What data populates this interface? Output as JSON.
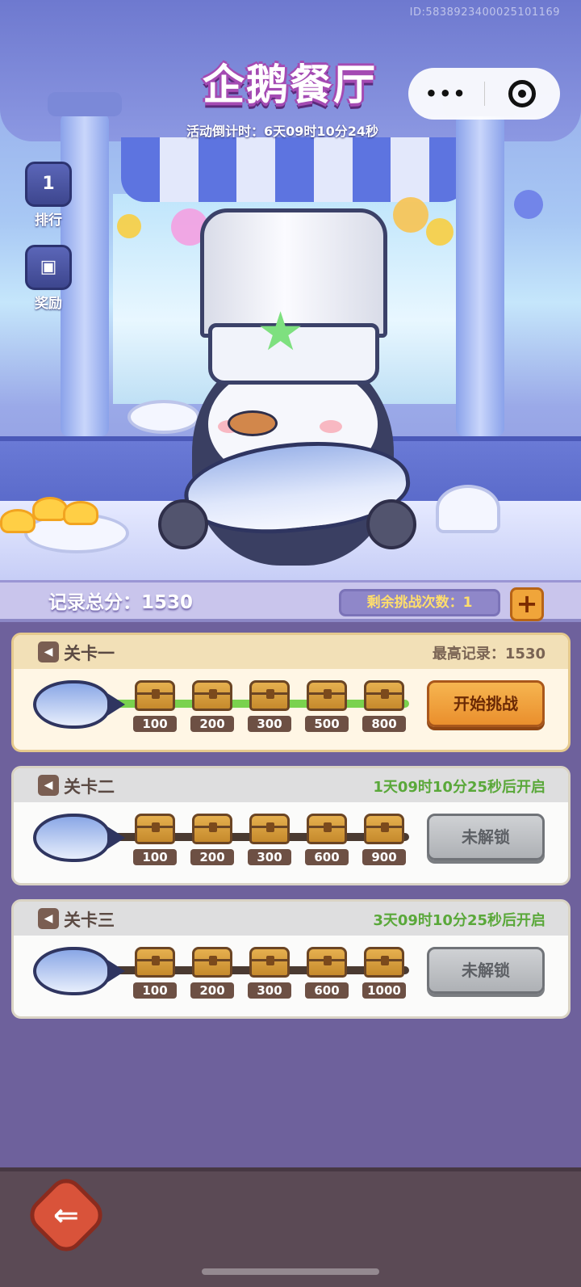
{
  "header": {
    "device_id": "ID:5838923400025101169",
    "title": "企鹅餐厅",
    "countdown": "活动倒计时：6天09时10分24秒",
    "capsule": {
      "more_icon": "more-dots-icon",
      "close_icon": "mini-program-close-icon"
    }
  },
  "side_buttons": [
    {
      "label": "排行",
      "icon": "ranking-podium-icon",
      "badge": "1"
    },
    {
      "label": "奖励",
      "icon": "treasure-chest-icon"
    }
  ],
  "score": {
    "total_label": "记录总分：1530",
    "remaining_label": "剩余挑战次数：1",
    "add_icon": "plus-icon"
  },
  "levels": [
    {
      "name": "关卡一",
      "status_text": "最高记录：1530",
      "status_color": "#7a6454",
      "milestones": [
        "100",
        "200",
        "300",
        "500",
        "800"
      ],
      "button": "开始挑战",
      "unlocked": true
    },
    {
      "name": "关卡二",
      "status_text": "1天09时10分25秒后开启",
      "status_color": "#5aa83a",
      "milestones": [
        "100",
        "200",
        "300",
        "600",
        "900"
      ],
      "button": "未解锁",
      "unlocked": false
    },
    {
      "name": "关卡三",
      "status_text": "3天09时10分25秒后开启",
      "status_color": "#5aa83a",
      "milestones": [
        "100",
        "200",
        "300",
        "600",
        "1000"
      ],
      "button": "未解锁",
      "unlocked": false
    }
  ],
  "footer": {
    "back_icon": "back-arrow-icon"
  },
  "colors": {
    "background": "#6e619c",
    "start_button": "#ea8f2d",
    "locked_button": "#aeb1b5",
    "countdown_green": "#5aa83a"
  }
}
